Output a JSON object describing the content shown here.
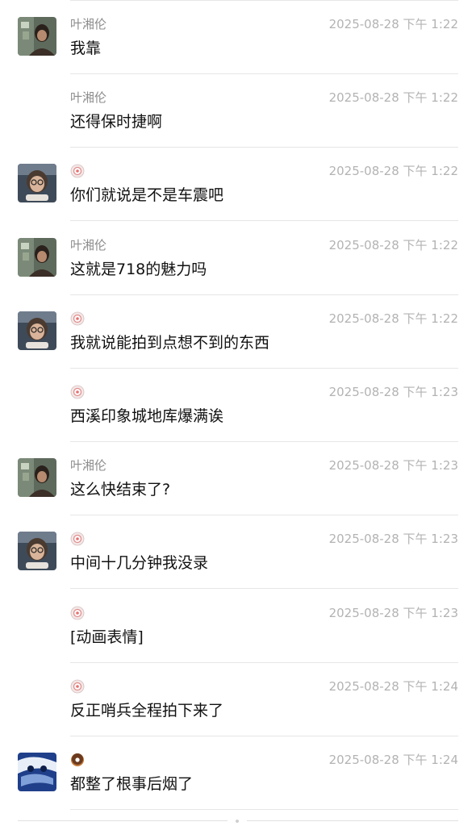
{
  "messages": [
    {
      "sender": "叶湘伦",
      "sender_type": "name",
      "avatar": "photo-male-dark",
      "time": "2025-08-28 下午 1:22",
      "text": "我靠"
    },
    {
      "sender": "叶湘伦",
      "sender_type": "name",
      "avatar": "none",
      "time": "2025-08-28 下午 1:22",
      "text": "还得保时捷啊"
    },
    {
      "sender": "",
      "sender_type": "emoji-bubble",
      "avatar": "photo-female-glasses",
      "time": "2025-08-28 下午 1:22",
      "text": "你们就说是不是车震吧"
    },
    {
      "sender": "叶湘伦",
      "sender_type": "name",
      "avatar": "photo-male-dark",
      "time": "2025-08-28 下午 1:22",
      "text": "这就是718的魅力吗"
    },
    {
      "sender": "",
      "sender_type": "emoji-bubble",
      "avatar": "photo-female-glasses",
      "time": "2025-08-28 下午 1:22",
      "text": "我就说能拍到点想不到的东西"
    },
    {
      "sender": "",
      "sender_type": "emoji-bubble",
      "avatar": "none",
      "time": "2025-08-28 下午 1:23",
      "text": "西溪印象城地库爆满诶"
    },
    {
      "sender": "叶湘伦",
      "sender_type": "name",
      "avatar": "photo-male-dark",
      "time": "2025-08-28 下午 1:23",
      "text": "这么快结束了?"
    },
    {
      "sender": "",
      "sender_type": "emoji-bubble",
      "avatar": "photo-female-glasses",
      "time": "2025-08-28 下午 1:23",
      "text": "中间十几分钟我没录"
    },
    {
      "sender": "",
      "sender_type": "emoji-bubble",
      "avatar": "none",
      "time": "2025-08-28 下午 1:23",
      "text": "[动画表情]"
    },
    {
      "sender": "",
      "sender_type": "emoji-bubble",
      "avatar": "none",
      "time": "2025-08-28 下午 1:24",
      "text": "反正哨兵全程拍下来了"
    },
    {
      "sender": "",
      "sender_type": "emoji-donut",
      "avatar": "photo-blue-art",
      "time": "2025-08-28 下午 1:24",
      "text": "都整了根事后烟了"
    }
  ]
}
